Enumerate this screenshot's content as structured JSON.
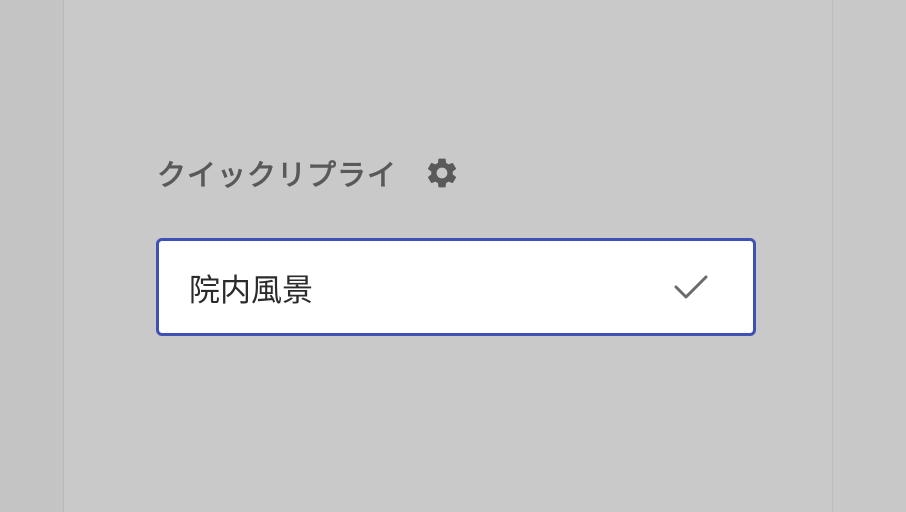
{
  "quick_reply": {
    "title": "クイックリプライ",
    "settings_icon": "gear-icon",
    "options": [
      {
        "label": "院内風景",
        "selected": true,
        "selected_icon": "check-icon"
      }
    ]
  },
  "colors": {
    "background": "#c9c9c9",
    "title_text": "#595959",
    "selected_border": "#3f51b5",
    "option_background": "#ffffff",
    "check": "#6b6b6b"
  }
}
